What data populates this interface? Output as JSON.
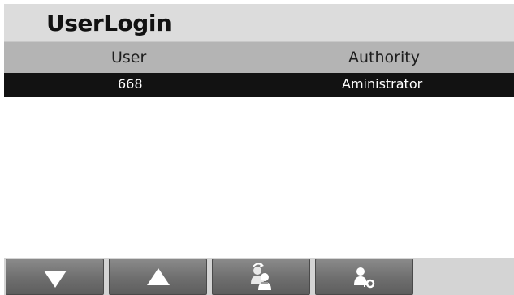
{
  "window": {
    "title": "UserLogin"
  },
  "table": {
    "columns": [
      "User",
      "Authority"
    ],
    "rows": [
      {
        "user": "668",
        "authority": "Aministrator"
      }
    ]
  },
  "toolbar": {
    "buttons": [
      {
        "icon": "triangle-down-icon"
      },
      {
        "icon": "triangle-up-icon"
      },
      {
        "icon": "switch-user-icon"
      },
      {
        "icon": "user-key-icon"
      }
    ]
  },
  "colors": {
    "title_bar": "#dcdcdc",
    "header_row": "#b4b4b4",
    "selected_row": "#121212",
    "button_face": "#6e6e6e"
  }
}
